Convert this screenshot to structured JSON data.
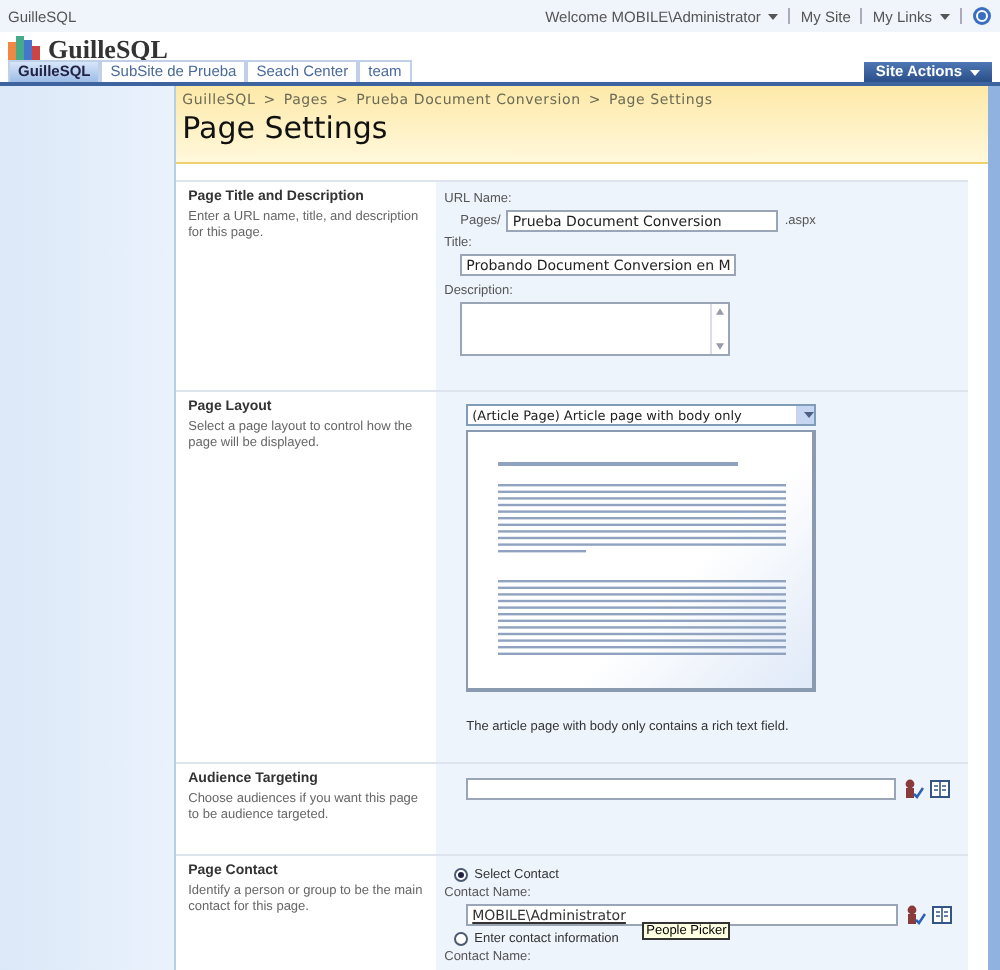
{
  "top_bar": {
    "site": "GuilleSQL",
    "welcome": "Welcome MOBILE\\Administrator",
    "links": [
      "My Site",
      "My Links"
    ]
  },
  "header": {
    "title": "GuilleSQL"
  },
  "tabs": [
    {
      "label": "GuilleSQL",
      "selected": true
    },
    {
      "label": "SubSite de Prueba",
      "selected": false
    },
    {
      "label": "Seach Center",
      "selected": false
    },
    {
      "label": "team",
      "selected": false
    }
  ],
  "site_actions": "Site Actions",
  "breadcrumb": {
    "items": [
      "GuilleSQL",
      "Pages",
      "Prueba Document Conversion",
      "Page Settings"
    ],
    "separator": ">"
  },
  "page_title": "Page Settings",
  "sections": [
    {
      "kind": "title_description",
      "title": "Page Title and Description",
      "description": "Enter a URL name, title, and description for this page.",
      "url_label": "URL Name:",
      "url_prefix": "Pages/",
      "url_value": "Prueba Document Conversion",
      "url_suffix": ".aspx",
      "title_label": "Title:",
      "title_value": "Probando Document Conversion en M",
      "description_label": "Description:"
    },
    {
      "kind": "layout",
      "title": "Page Layout",
      "description": "Select a page layout to control how the page will be displayed.",
      "select_value": "(Article Page) Article page with body only",
      "caption": "The article page with body only contains a rich text field."
    },
    {
      "kind": "audience",
      "title": "Audience Targeting",
      "description": "Choose audiences if you want this page to be audience targeted."
    },
    {
      "kind": "contact",
      "title": "Page Contact",
      "description": "Identify a person or group to be the main contact for this page.",
      "options": [
        {
          "label": "Select Contact",
          "selected": true,
          "field_label": "Contact Name:",
          "value": "MOBILE\\Administrator",
          "tooltip": "People Picker"
        },
        {
          "label": "Enter contact information",
          "selected": false,
          "field_label": "Contact Name:"
        }
      ]
    }
  ]
}
